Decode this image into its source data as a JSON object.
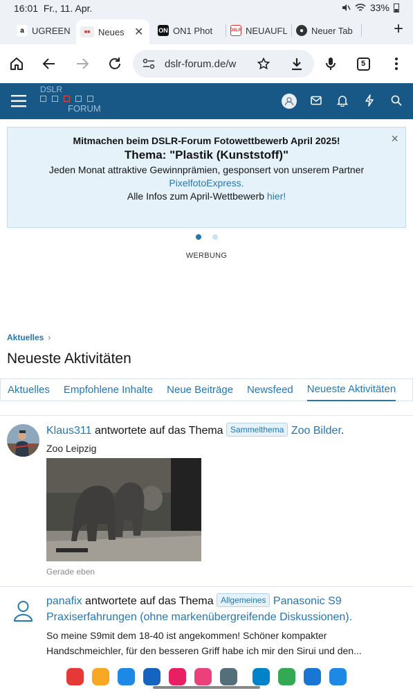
{
  "status": {
    "time": "16:01",
    "date": "Fr., 11. Apr.",
    "battery": "33%",
    "icons": [
      "mute-icon",
      "wifi-icon",
      "battery-icon"
    ]
  },
  "tabs": [
    {
      "title": "UGREEN",
      "icon": "amazon-favicon",
      "active": false
    },
    {
      "title": "Neues",
      "icon": "dslr-favicon",
      "active": true
    },
    {
      "title": "ON1 Phot",
      "icon": "on1-favicon",
      "active": false
    },
    {
      "title": "NEUAUFL",
      "icon": "dslr-forum-favicon",
      "active": false
    },
    {
      "title": "Neuer Tab",
      "icon": "chrome-favicon",
      "active": false
    }
  ],
  "toolbar": {
    "url": "dslr-forum.de/w",
    "tab_count": "5"
  },
  "forum": {
    "logo_top": "DSLR",
    "logo_bottom": "FORUM"
  },
  "notice": {
    "line1": "Mitmachen beim DSLR-Forum Fotowettbewerb April 2025!",
    "line2": "Thema: \"Plastik (Kunststoff)\"",
    "line3": "Jeden Monat attraktive Gewinnprämien, gesponsert von unserem Partner",
    "link_partner": "PixelfotoExpress.",
    "line5_prefix": "Alle Infos zum April-Wettbewerb ",
    "link_here": "hier!",
    "close": "×"
  },
  "ad_label": "WERBUNG",
  "breadcrumb": "Aktuelles",
  "page_title": "Neueste Aktivitäten",
  "subnav": [
    {
      "label": "Aktuelles",
      "active": false
    },
    {
      "label": "Empfohlene Inhalte",
      "active": false
    },
    {
      "label": "Neue Beiträge",
      "active": false
    },
    {
      "label": "Newsfeed",
      "active": false
    },
    {
      "label": "Neueste Aktivitäten",
      "active": true
    }
  ],
  "activities": [
    {
      "user": "Klaus311",
      "action": " antwortete auf das Thema ",
      "prefix": "Sammelthema",
      "thread": "Zoo Bilder",
      "end": ".",
      "snippet": "Zoo Leipzig",
      "time": "Gerade eben"
    },
    {
      "user": "panafix",
      "action": " antwortete auf das Thema ",
      "prefix": "Allgemeines",
      "thread": "Panasonic S9 Praxiserfahrungen (ohne markenübergreifende Diskussionen).",
      "snippet": "So meine S9mit dem 18-40 ist angekommen! Schöner kompakter Handschmeichler, für den besseren Griff habe ich mir den Sirui und den..."
    }
  ],
  "dock_apps": [
    {
      "name": "flipboard-app-icon",
      "color": "#e53935"
    },
    {
      "name": "files-app-icon",
      "color": "#f9a825"
    },
    {
      "name": "calendar-app-icon",
      "color": "#1e88e5"
    },
    {
      "name": "messages-app-icon",
      "color": "#1565c0"
    },
    {
      "name": "camera-app-icon",
      "color": "#e91e63"
    },
    {
      "name": "gallery-app-icon",
      "color": "#ec407a"
    },
    {
      "name": "apps-grid-icon",
      "color": "#546e7a"
    },
    {
      "name": "nextcloud-app-icon",
      "color": "#0082c9"
    },
    {
      "name": "play-store-app-icon",
      "color": "#34a853"
    },
    {
      "name": "browser-app-icon",
      "color": "#1976d2"
    },
    {
      "name": "notes-app-icon",
      "color": "#1e88e5"
    }
  ],
  "colors": {
    "header": "#185886",
    "link": "#2577b1",
    "notice_bg": "#e5f2fa"
  }
}
